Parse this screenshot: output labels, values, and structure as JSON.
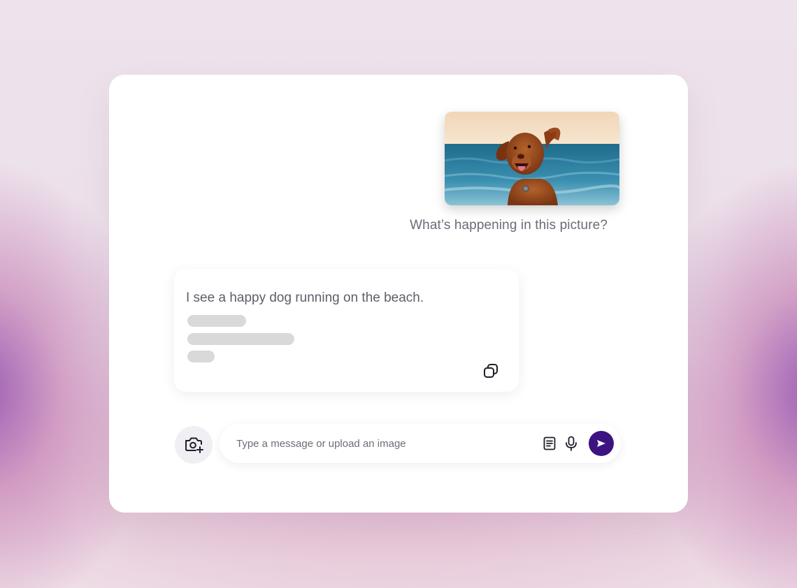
{
  "conversation": {
    "user_image": {
      "subject": "dog-on-beach-photo"
    },
    "user_message": "What’s happening in this picture?",
    "assistant_reply": {
      "text": "I see a happy dog running on the beach.",
      "copy_icon": "copy-icon"
    }
  },
  "composer": {
    "camera_icon": "camera-plus-icon",
    "placeholder": "Type a message or upload an image",
    "value": "",
    "document_icon": "document-icon",
    "mic_icon": "microphone-icon",
    "send_icon": "send-icon"
  },
  "colors": {
    "accent": "#3c1380",
    "text_muted": "#6b6b78",
    "skeleton": "#d9d9d9"
  }
}
